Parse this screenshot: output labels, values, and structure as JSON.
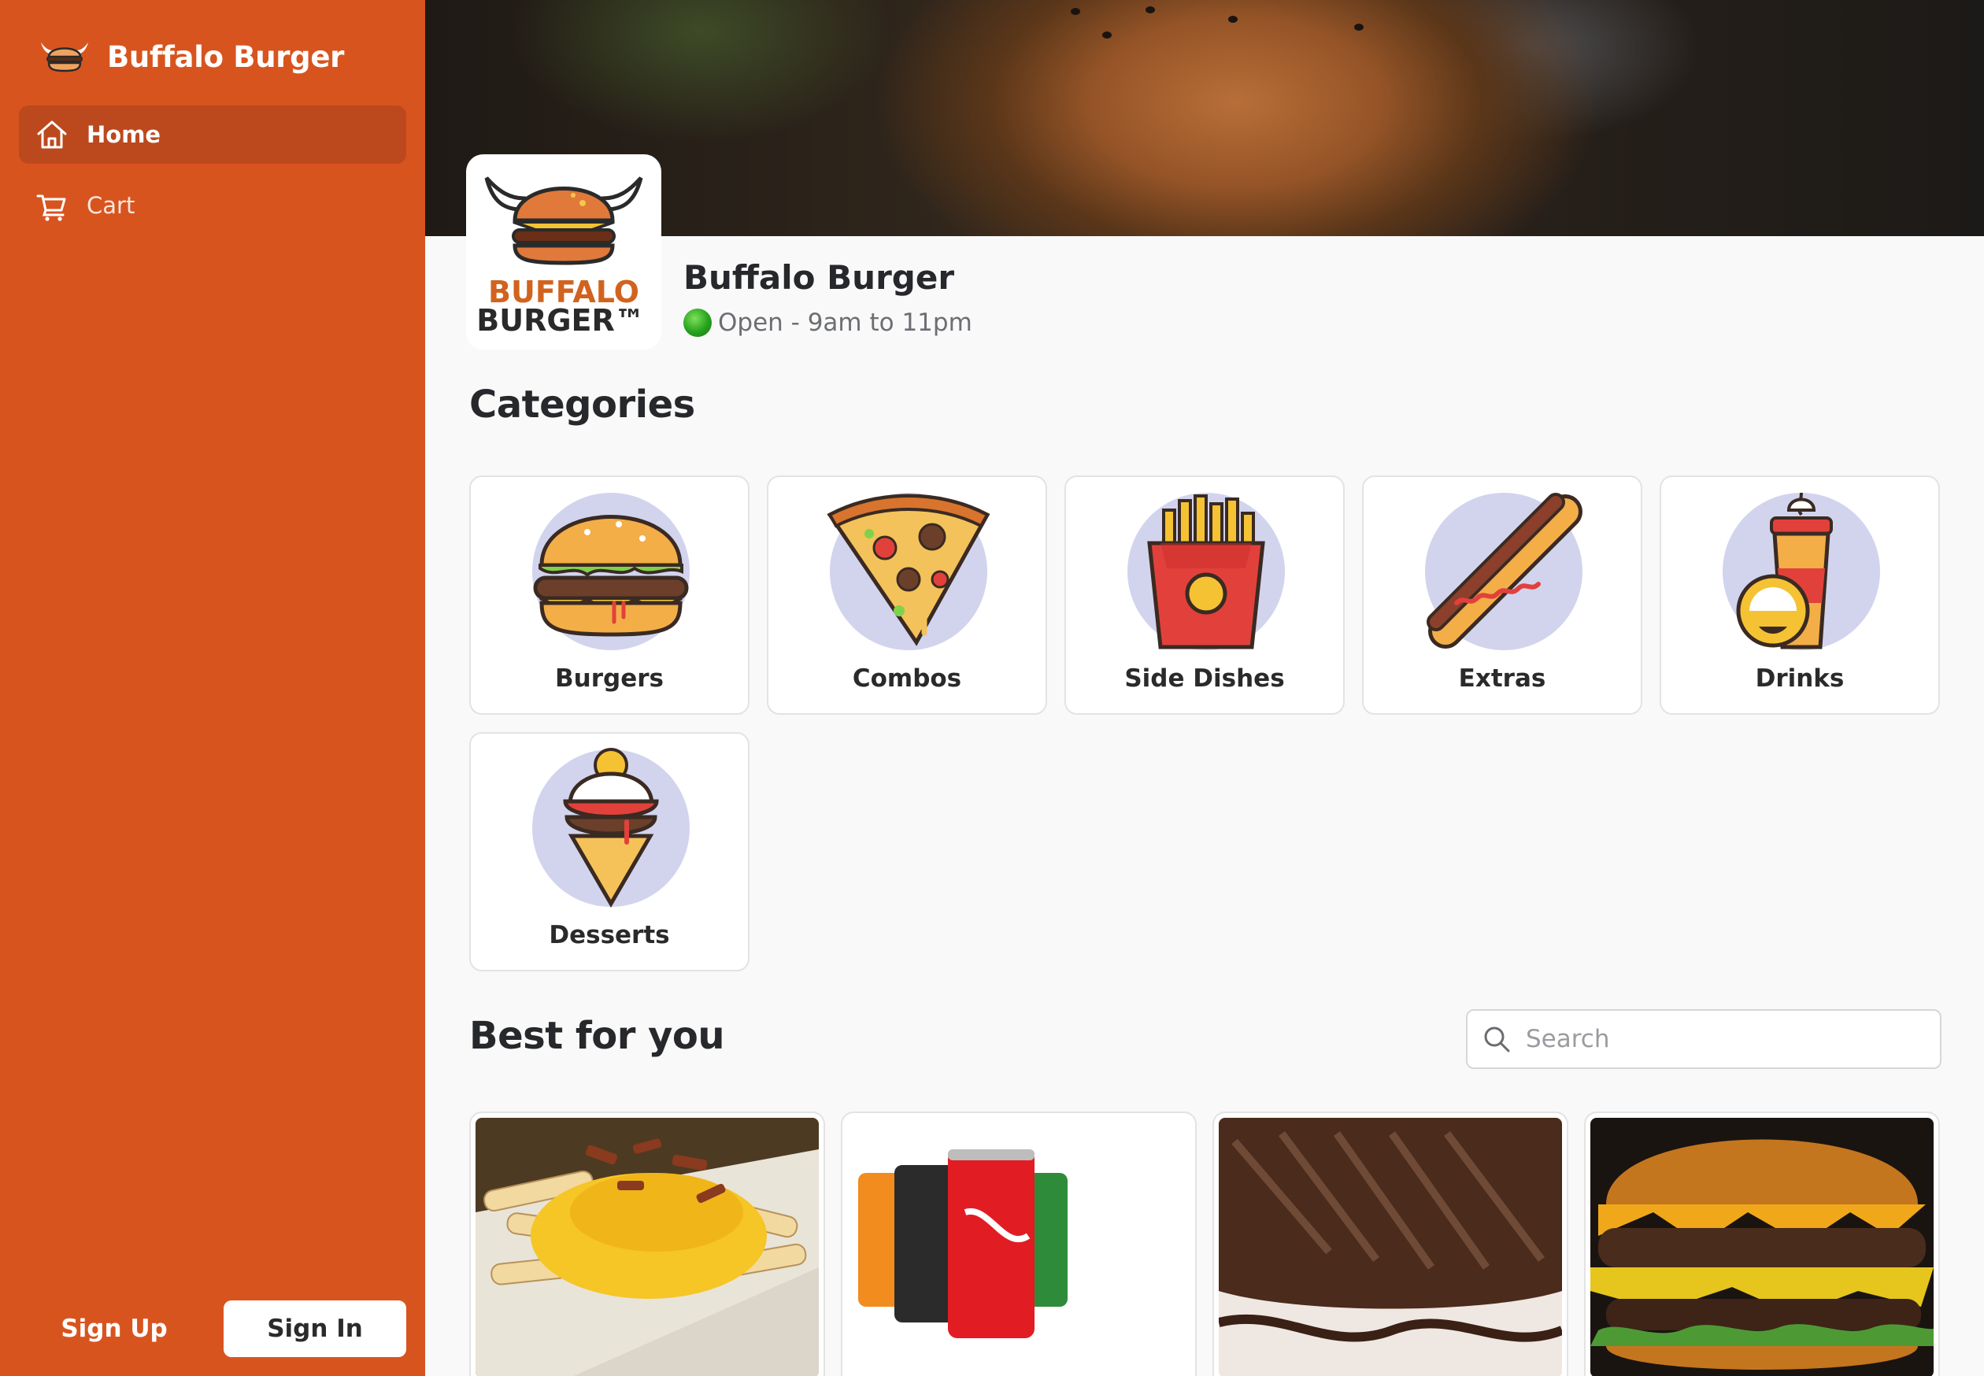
{
  "app": {
    "brand_name": "Buffalo Burger",
    "brand_color": "#d8541f"
  },
  "sidebar": {
    "items": [
      {
        "label": "Home",
        "icon": "home-icon",
        "active": true
      },
      {
        "label": "Cart",
        "icon": "cart-icon",
        "active": false
      }
    ],
    "signup_label": "Sign Up",
    "signin_label": "Sign In"
  },
  "restaurant": {
    "name": "Buffalo Burger",
    "status": "Open - 9am to 11pm",
    "status_color": "#25a11d",
    "logo_text_line1": "BUFFALO",
    "logo_text_line2": "BURGER™"
  },
  "categories": {
    "title": "Categories",
    "items": [
      {
        "label": "Burgers",
        "icon": "burger-icon"
      },
      {
        "label": "Combos",
        "icon": "pizza-icon"
      },
      {
        "label": "Side Dishes",
        "icon": "fries-icon"
      },
      {
        "label": "Extras",
        "icon": "hotdog-icon"
      },
      {
        "label": "Drinks",
        "icon": "drink-icon"
      },
      {
        "label": "Desserts",
        "icon": "ice-cream-icon"
      }
    ]
  },
  "best": {
    "title": "Best for you",
    "search_placeholder": "Search",
    "products": [
      {
        "image": "cheese-fries-photo"
      },
      {
        "image": "soda-cans-photo"
      },
      {
        "image": "chocolate-cake-photo"
      },
      {
        "image": "cheeseburger-photo"
      }
    ]
  }
}
